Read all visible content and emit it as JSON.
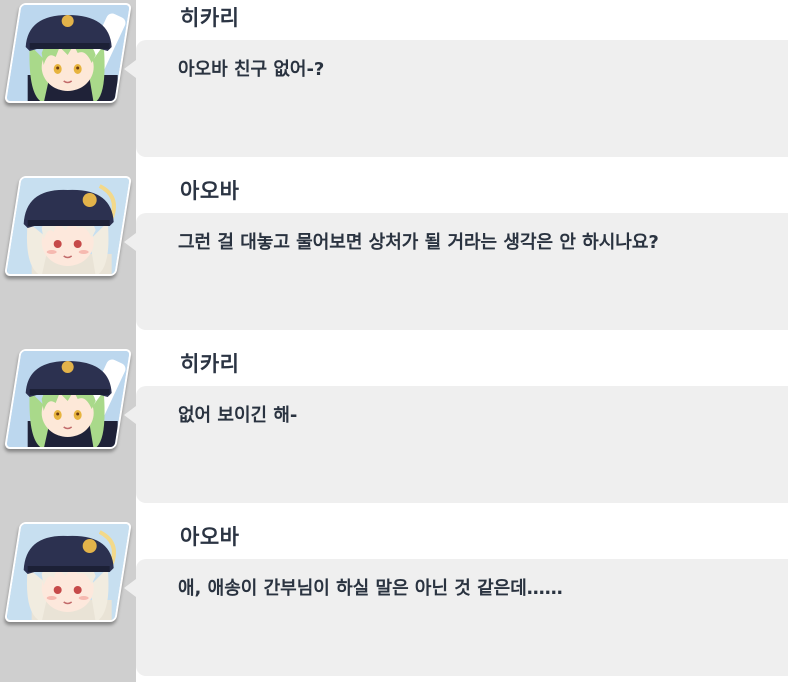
{
  "entries": [
    {
      "speaker": "히카리",
      "line": "아오바 친구 없어-?",
      "character": "hikari"
    },
    {
      "speaker": "아오바",
      "line": "그런 걸 대놓고 물어보면 상처가 될 거라는 생각은 안 하시나요?",
      "character": "aoba"
    },
    {
      "speaker": "히카리",
      "line": "없어 보이긴 해-",
      "character": "hikari"
    },
    {
      "speaker": "아오바",
      "line": "애, 애송이 간부님이 하실 말은 아닌 것 같은데……",
      "character": "aoba"
    }
  ],
  "colors": {
    "hikari_hair": "#a9d98a",
    "aoba_hair": "#f1ece0",
    "cap": "#2c3150",
    "cap_badge": "#e3b34a",
    "bubble": "#efefef",
    "gutter": "#cfcfcf",
    "text": "#2a3340"
  }
}
